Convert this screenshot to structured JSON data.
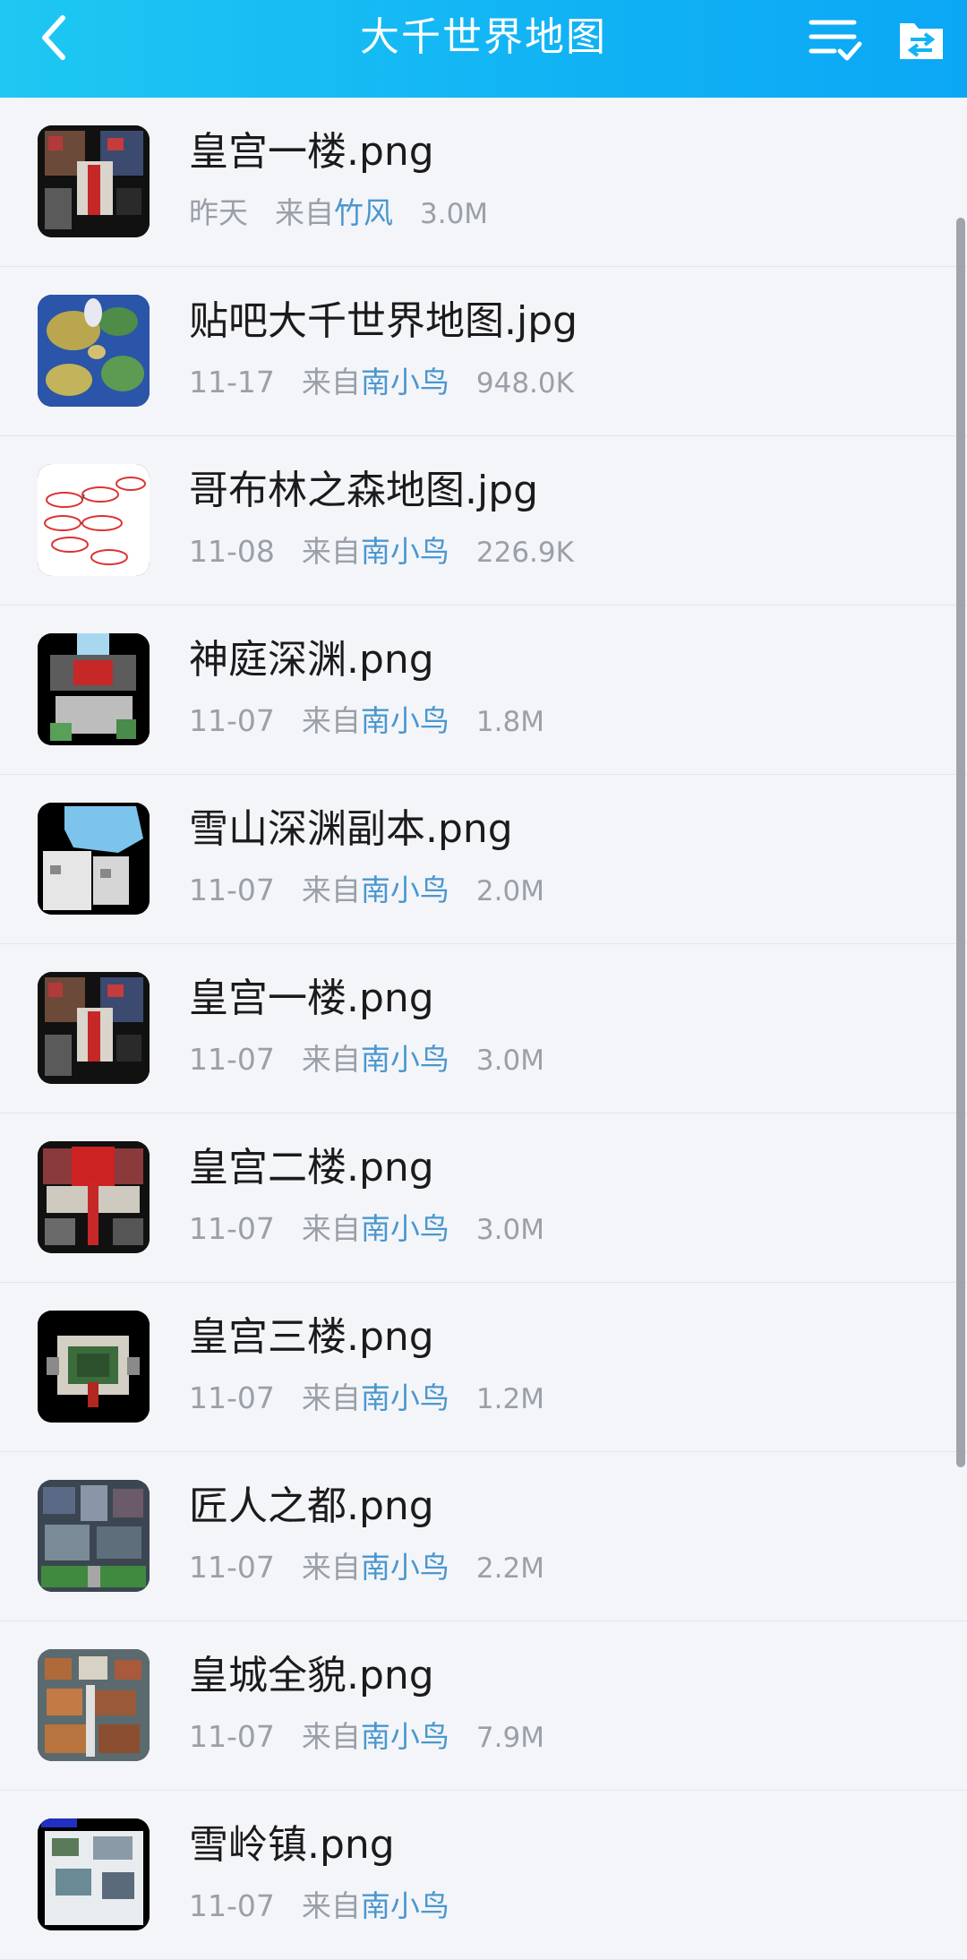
{
  "header": {
    "title": "大千世界地图",
    "back_icon": "chevron-left-icon",
    "select_icon": "list-check-icon",
    "transfer_icon": "folder-transfer-icon",
    "background": "#12b4f4"
  },
  "files": [
    {
      "name": "皇宫一楼.png",
      "date": "昨天",
      "from": "来自",
      "uploader": "竹风",
      "size": "3.0M",
      "thumb": "palace-floor1"
    },
    {
      "name": "贴吧大千世界地图.jpg",
      "date": "11-17",
      "from": "来自",
      "uploader": "南小鸟",
      "size": "948.0K",
      "thumb": "world-map"
    },
    {
      "name": "哥布林之森地图.jpg",
      "date": "11-08",
      "from": "来自",
      "uploader": "南小鸟",
      "size": "226.9K",
      "thumb": "goblin-forest"
    },
    {
      "name": "神庭深渊.png",
      "date": "11-07",
      "from": "来自",
      "uploader": "南小鸟",
      "size": "1.8M",
      "thumb": "divine-abyss"
    },
    {
      "name": "雪山深渊副本.png",
      "date": "11-07",
      "from": "来自",
      "uploader": "南小鸟",
      "size": "2.0M",
      "thumb": "snow-abyss"
    },
    {
      "name": "皇宫一楼.png",
      "date": "11-07",
      "from": "来自",
      "uploader": "南小鸟",
      "size": "3.0M",
      "thumb": "palace-floor1"
    },
    {
      "name": "皇宫二楼.png",
      "date": "11-07",
      "from": "来自",
      "uploader": "南小鸟",
      "size": "3.0M",
      "thumb": "palace-floor2"
    },
    {
      "name": "皇宫三楼.png",
      "date": "11-07",
      "from": "来自",
      "uploader": "南小鸟",
      "size": "1.2M",
      "thumb": "palace-floor3"
    },
    {
      "name": "匠人之都.png",
      "date": "11-07",
      "from": "来自",
      "uploader": "南小鸟",
      "size": "2.2M",
      "thumb": "artisan-city"
    },
    {
      "name": "皇城全貌.png",
      "date": "11-07",
      "from": "来自",
      "uploader": "南小鸟",
      "size": "7.9M",
      "thumb": "imperial-city"
    },
    {
      "name": "雪岭镇.png",
      "date": "11-07",
      "from": "来自",
      "uploader": "南小鸟",
      "size": "",
      "thumb": "snow-town"
    }
  ],
  "colors": {
    "uploader": "#4a97cf",
    "meta": "#9aa0a8",
    "background": "#f4f5f9"
  }
}
